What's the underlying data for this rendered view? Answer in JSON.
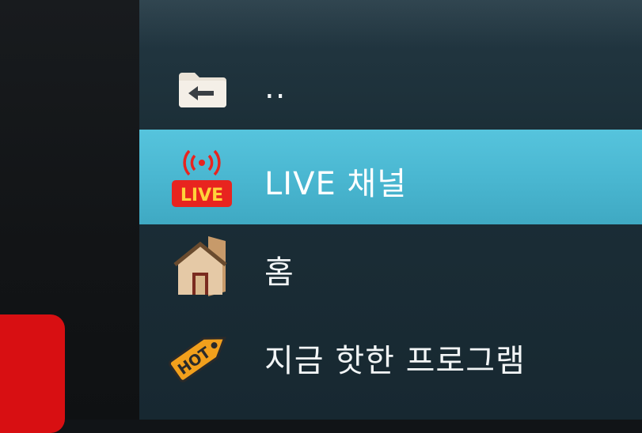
{
  "menu": {
    "items": [
      {
        "label": "..",
        "icon": "folder-back-icon"
      },
      {
        "label": "LIVE 채널",
        "icon": "live-icon",
        "badge": "LIVE"
      },
      {
        "label": "홈",
        "icon": "home-icon"
      },
      {
        "label": "지금 핫한 프로그램",
        "icon": "hot-tag-icon",
        "badge": "HOT"
      }
    ],
    "selected_index": 1
  },
  "colors": {
    "highlight": "#4ab7d1",
    "menu_bg": "#1c2f38",
    "live_red": "#e8241f",
    "hot_orange": "#f2a01c"
  }
}
